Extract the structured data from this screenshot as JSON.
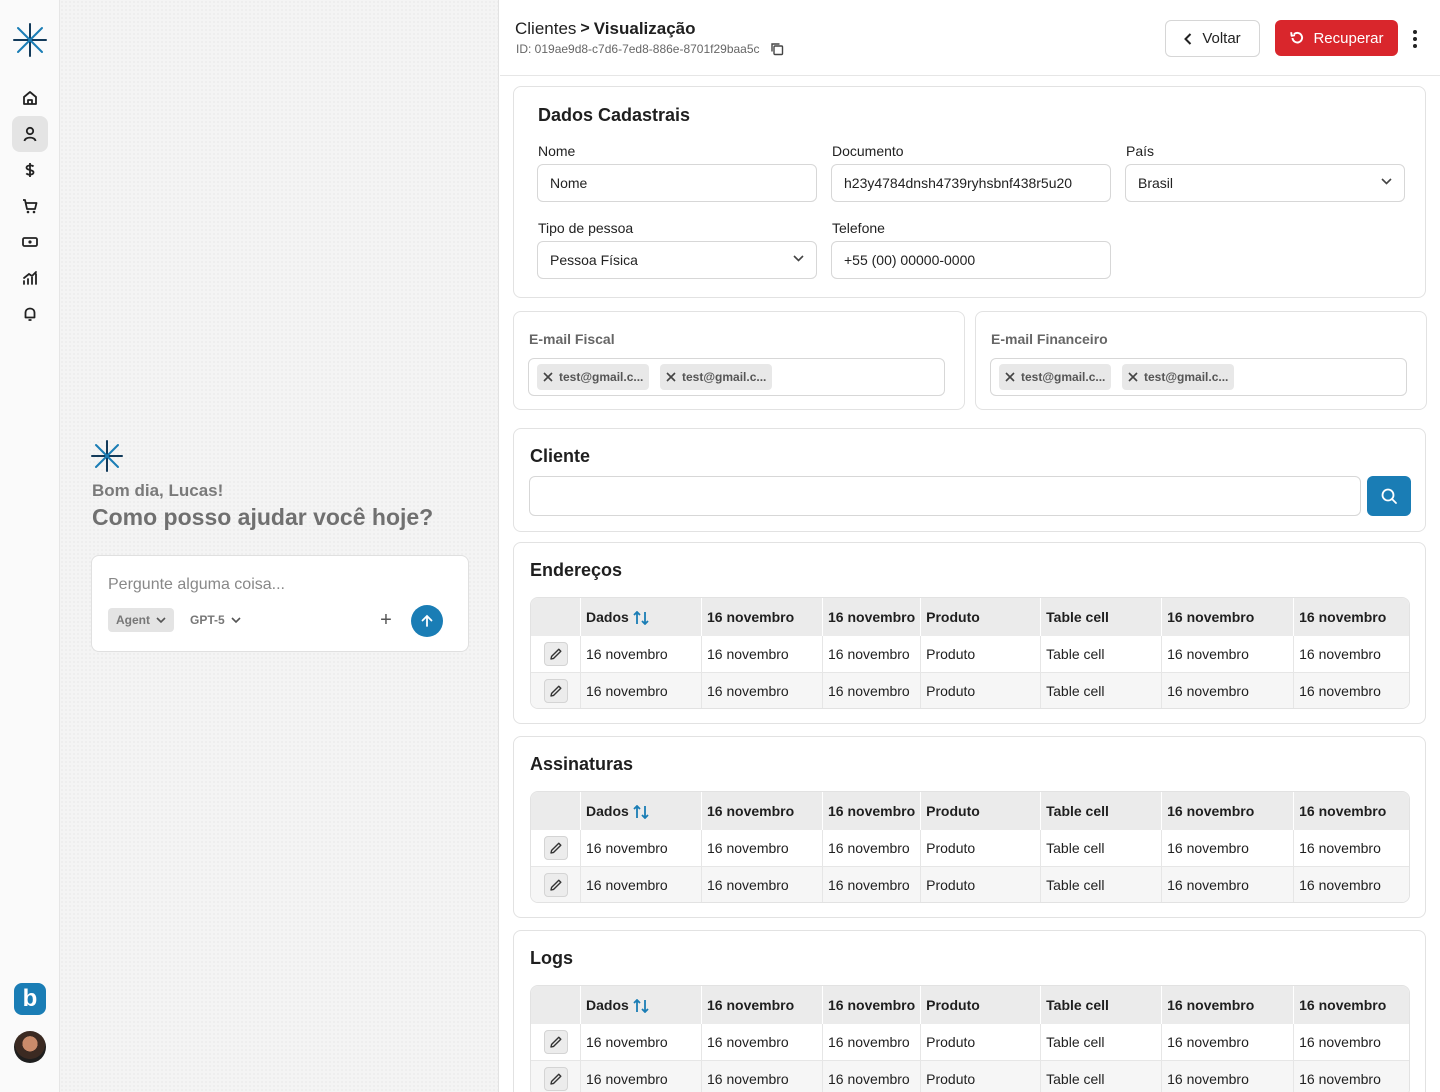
{
  "header": {
    "breadcrumb_parent": "Clientes",
    "breadcrumb_sep": ">",
    "breadcrumb_current": "Visualização",
    "record_id": "ID: 019ae9d8-c7d6-7ed8-886e-8701f29baa5c",
    "back_label": "Voltar",
    "recover_label": "Recuperar"
  },
  "sidebar": {
    "items": [
      "home-icon",
      "user-icon",
      "dollar-icon",
      "cart-icon",
      "ticket-icon",
      "chart-icon",
      "bell-icon"
    ],
    "active_item": "user-icon",
    "app_badge": "b"
  },
  "assistant": {
    "greeting": "Bom dia, Lucas!",
    "question": "Como posso ajudar você hoje?",
    "input_placeholder": "Pergunte alguma coisa...",
    "mode_label": "Agent",
    "model_label": "GPT-5",
    "plus_label": "+"
  },
  "dados": {
    "title": "Dados Cadastrais",
    "nome_label": "Nome",
    "nome_value": "Nome",
    "documento_label": "Documento",
    "documento_value": "h23y4784dnsh4739ryhsbnf438r5u20",
    "pais_label": "País",
    "pais_value": "Brasil",
    "tipo_label": "Tipo de pessoa",
    "tipo_value": "Pessoa Física",
    "telefone_label": "Telefone",
    "telefone_value": "+55 (00) 00000-0000"
  },
  "email_fiscal": {
    "title": "E-mail Fiscal",
    "chips": [
      "test@gmail.c...",
      "test@gmail.c..."
    ]
  },
  "email_financeiro": {
    "title": "E-mail Financeiro",
    "chips": [
      "test@gmail.c...",
      "test@gmail.c..."
    ]
  },
  "cliente": {
    "title": "Cliente",
    "search_value": ""
  },
  "tables": {
    "columns": [
      "Dados",
      "16 novembro",
      "16 novembro",
      "Produto",
      "Table cell",
      "16 novembro",
      "16 novembro"
    ],
    "row": [
      "16 novembro",
      "16 novembro",
      "16 novembro",
      "Produto",
      "Table cell",
      "16 novembro",
      "16 novembro"
    ],
    "enderecos_title": "Endereços",
    "assinaturas_title": "Assinaturas",
    "logs_title": "Logs"
  },
  "colors": {
    "accent": "#1a7db5",
    "danger": "#d9262c"
  }
}
